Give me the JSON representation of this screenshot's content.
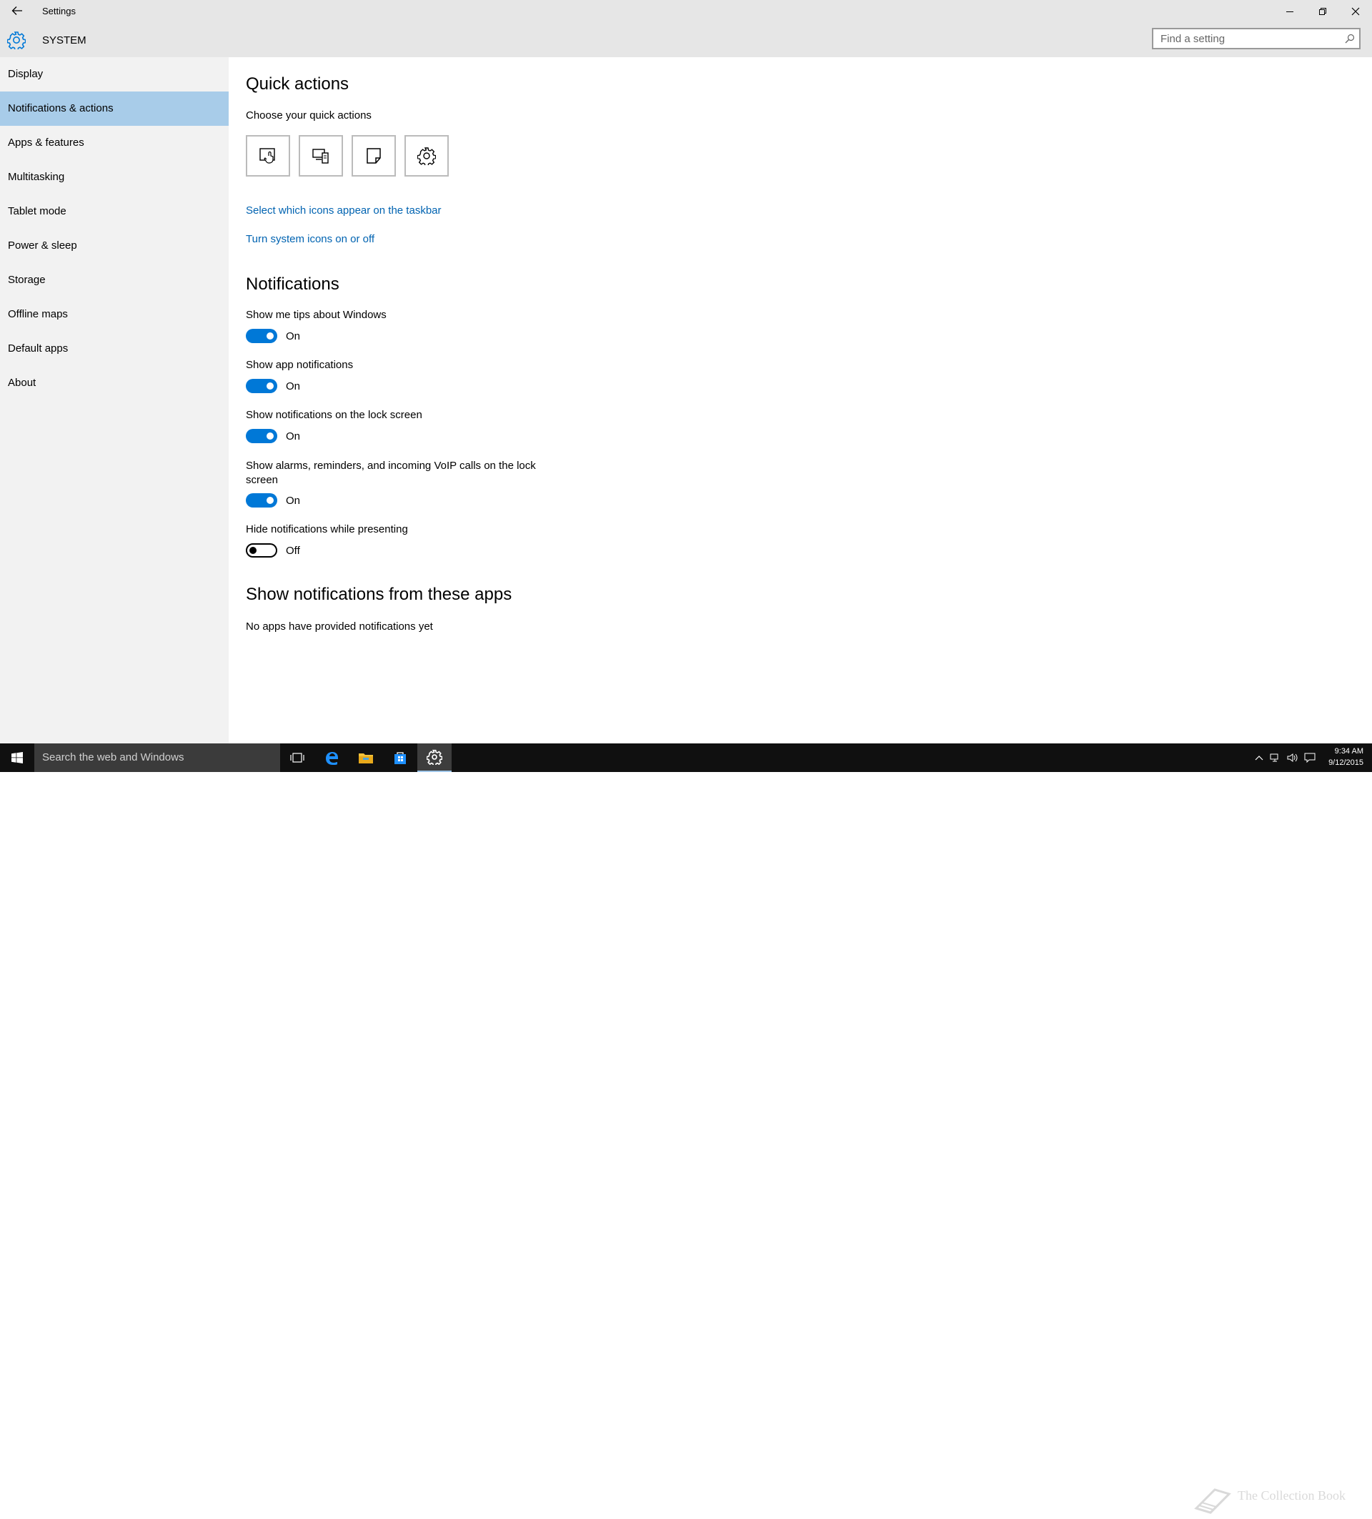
{
  "window": {
    "title": "Settings",
    "controls": {
      "minimize": "minimize-icon",
      "restore": "restore-icon",
      "close": "close-icon"
    }
  },
  "header": {
    "app_name": "SYSTEM",
    "icon": "gear-icon"
  },
  "search": {
    "placeholder": "Find a setting",
    "value": ""
  },
  "sidebar": {
    "items": [
      {
        "label": "Display",
        "active": false
      },
      {
        "label": "Notifications & actions",
        "active": true
      },
      {
        "label": "Apps & features",
        "active": false
      },
      {
        "label": "Multitasking",
        "active": false
      },
      {
        "label": "Tablet mode",
        "active": false
      },
      {
        "label": "Power & sleep",
        "active": false
      },
      {
        "label": "Storage",
        "active": false
      },
      {
        "label": "Offline maps",
        "active": false
      },
      {
        "label": "Default apps",
        "active": false
      },
      {
        "label": "About",
        "active": false
      }
    ]
  },
  "quick_actions": {
    "heading": "Quick actions",
    "subheading": "Choose your quick actions",
    "buttons": [
      "tablet-mode-icon",
      "connect-icon",
      "note-icon",
      "all-settings-icon"
    ],
    "link_taskbar_icons": "Select which icons appear on the taskbar",
    "link_system_icons": "Turn system icons on or off"
  },
  "notifications": {
    "heading": "Notifications",
    "settings": [
      {
        "label": "Show me tips about Windows",
        "state": "On",
        "on": true
      },
      {
        "label": "Show app notifications",
        "state": "On",
        "on": true
      },
      {
        "label": "Show notifications on the lock screen",
        "state": "On",
        "on": true
      },
      {
        "label": "Show alarms, reminders, and incoming VoIP calls on the lock screen",
        "state": "On",
        "on": true
      },
      {
        "label": "Hide notifications while presenting",
        "state": "Off",
        "on": false
      }
    ]
  },
  "apps_section": {
    "heading": "Show notifications from these apps",
    "empty_text": "No apps have provided notifications yet"
  },
  "taskbar": {
    "search_placeholder": "Search the web and Windows",
    "time": "9:34 AM",
    "date": "9/12/2015",
    "watermark": "The Collection Book"
  },
  "colors": {
    "accent": "#0078d7",
    "link": "#0063b1",
    "nav_selected": "#a8cce9",
    "titlebar": "#e6e6e6",
    "sidebar": "#f2f2f2",
    "taskbar": "#101010"
  }
}
